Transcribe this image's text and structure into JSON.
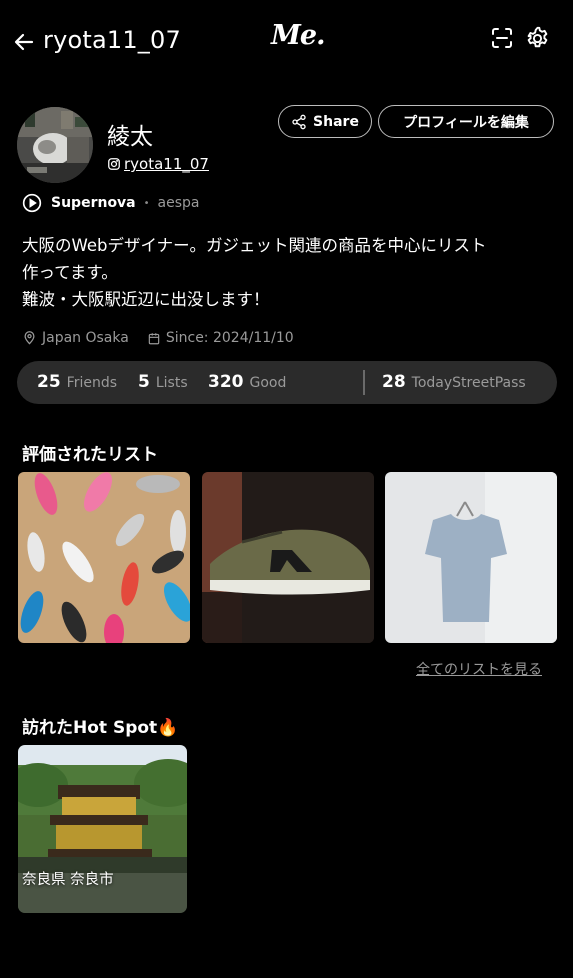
{
  "header": {
    "username": "ryota11_07",
    "logo": "Me.",
    "icons": [
      "back-arrow-icon",
      "scan-icon",
      "gear-icon"
    ]
  },
  "profile": {
    "display_name": "綾太",
    "instagram_handle": "ryota11_07",
    "share_label": "Share",
    "edit_label": "プロフィールを編集",
    "song_title": "Supernova",
    "song_artist": "aespa",
    "bio_line1": "大阪のWebデザイナー。ガジェット関連の商品を中心にリスト",
    "bio_line2": "作ってます。",
    "bio_line3": "難波・大阪駅近辺に出没します！",
    "location": "Japan Osaka",
    "since": "Since: 2024/11/10"
  },
  "stats": {
    "friends_count": "25",
    "friends_label": "Friends",
    "lists_count": "5",
    "lists_label": "Lists",
    "good_count": "320",
    "good_label": "Good",
    "streetpass_count": "28",
    "streetpass_label": "TodayStreetPass"
  },
  "rated_lists": {
    "title": "評価されたリスト",
    "see_all_label": "全てのリストを見る"
  },
  "hot_spot": {
    "title": "訪れたHot Spot🔥",
    "spot_label": "奈良県 奈良市"
  },
  "colors": {
    "background": "#000000",
    "stats_bar": "#2b2b2b",
    "muted_text": "#9a9a9a",
    "button_border": "#bdbdbd"
  }
}
